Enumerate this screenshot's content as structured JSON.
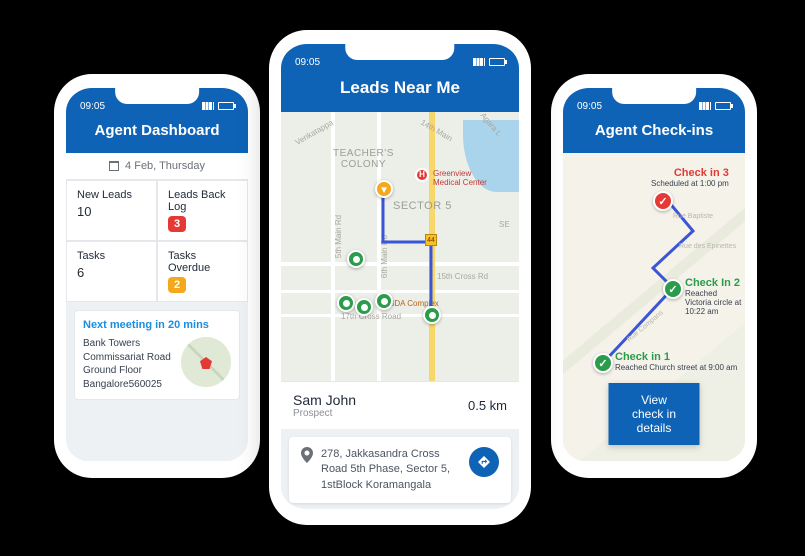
{
  "status_time": "09:05",
  "phone1": {
    "title": "Agent Dashboard",
    "date": "4 Feb, Thursday",
    "stats": {
      "new_leads_label": "New Leads",
      "new_leads_value": "10",
      "backlog_label": "Leads Back Log",
      "backlog_value": "3",
      "tasks_label": "Tasks",
      "tasks_value": "6",
      "overdue_label": "Tasks Overdue",
      "overdue_value": "2"
    },
    "meeting": {
      "title": "Next meeting in 20 mins",
      "line1": "Bank Towers",
      "line2": "Commissariat Road",
      "line3": "Ground Floor",
      "line4": "Bangalore560025"
    }
  },
  "phone2": {
    "title": "Leads Near Me",
    "map_labels": {
      "area1": "TEACHER'S\nCOLONY",
      "area2": "SECTOR 5",
      "poi1": "Greenview\nMedical Center",
      "poi2": "BDA Complex",
      "road1": "15th Cross Rd",
      "road2": "17th Cross Road",
      "road3": "Venkatappa",
      "road4": "5th Main Rd",
      "road5": "6th Main Rd",
      "road6": "14th Main",
      "road7": "Agara L",
      "road8": "SE",
      "route_marker": "44"
    },
    "lead": {
      "name": "Sam John",
      "type": "Prospect",
      "distance": "0.5 km"
    },
    "address": "278, Jakkasandra Cross Road 5th Phase, Sector 5, 1stBlock Koramangala"
  },
  "phone3": {
    "title": "Agent Check-ins",
    "checkins": [
      {
        "title": "Check in 3",
        "sub": "Scheduled at 1:00 pm",
        "color": "red"
      },
      {
        "title": "Check In 2",
        "sub": "Reached Victoria circle at 10:22 am",
        "color": "green"
      },
      {
        "title": "Check in 1",
        "sub": "Reached Church street at 9:00 am",
        "color": "green"
      }
    ],
    "road1": "Rue Baptiste",
    "road2": "Rue des Epinettes",
    "road3": "Rue Compans",
    "button": "View check in details"
  }
}
